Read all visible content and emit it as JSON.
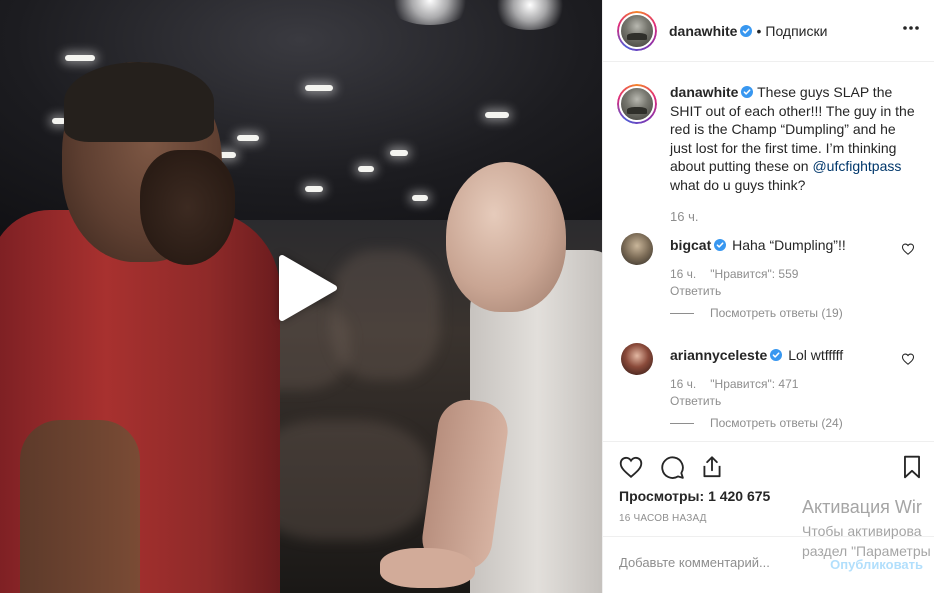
{
  "post": {
    "author": "danawhite",
    "follow_status": "Подписки",
    "separator": "•"
  },
  "caption": {
    "author": "danawhite",
    "text_before_mention": "These guys SLAP the SHIT out of each other!!! The guy in the red is the Champ “Dumpling” and he just lost for the first time. I’m thinking about putting these on ",
    "mention": "@ufcfightpass",
    "text_after_mention": " what do u guys think?",
    "time": "16 ч."
  },
  "comments": [
    {
      "author": "bigcat",
      "text": "Haha “Dumpling”!!",
      "time": "16 ч.",
      "likes": "\"Нравится\": 559",
      "reply_label": "Ответить",
      "view_replies": "Посмотреть ответы (19)"
    },
    {
      "author": "ariannyceleste",
      "text": "Lol wtfffff",
      "time": "16 ч.",
      "likes": "\"Нравится\": 471",
      "reply_label": "Ответить",
      "view_replies": "Посмотреть ответы (24)"
    }
  ],
  "stats": {
    "views_label": "Просмотры:",
    "views_value": "1 420 675",
    "time_ago": "16 часов назад"
  },
  "add_comment": {
    "placeholder": "Добавьте комментарий...",
    "publish_label": "Опубликовать"
  },
  "watermark": {
    "line1": "Активация Wir",
    "line2": "Чтобы активирова",
    "line3": "раздел \"Параметры"
  },
  "icons": {
    "play": "play-icon",
    "verified": "verified-badge-icon",
    "more": "more-horizontal-icon",
    "like": "heart-icon",
    "comment": "comment-bubble-icon",
    "share": "share-icon",
    "save": "bookmark-icon"
  },
  "colors": {
    "verified_blue": "#3897f0",
    "text_primary": "#262626",
    "text_secondary": "#8e8e8e",
    "mention_blue": "#00376b",
    "publish_disabled": "#b2dffc"
  }
}
